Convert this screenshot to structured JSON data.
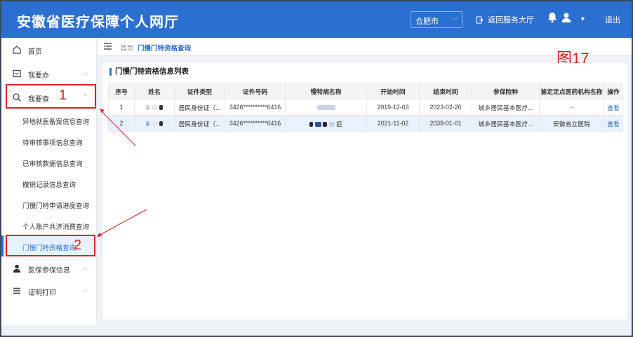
{
  "header": {
    "title": "安徽省医疗保障个人网厅",
    "city": "合肥市",
    "return_hall": "返回服务大厅",
    "logout": "退出"
  },
  "sidebar": {
    "items": [
      {
        "label": "首页"
      },
      {
        "label": "我要办"
      },
      {
        "label": "我要查"
      },
      {
        "label": "医保参保信息"
      },
      {
        "label": "证明打印"
      }
    ],
    "sub_items": [
      {
        "label": "异地就医备案信息查询"
      },
      {
        "label": "待审核事项信息查询"
      },
      {
        "label": "已审核数据信息查询"
      },
      {
        "label": "撤销记录信息查询"
      },
      {
        "label": "门慢门特申请进度查询"
      },
      {
        "label": "个人账户共济消费查询"
      },
      {
        "label": "门慢门特资格查询"
      }
    ]
  },
  "tabs": {
    "home": "首页",
    "active": "门慢门特资格查询",
    "close": "×"
  },
  "annotations": {
    "figure": "图17",
    "marker_1": "1",
    "marker_2": "2"
  },
  "panel": {
    "title": "门慢门特资格信息列表"
  },
  "table": {
    "headers": [
      "序号",
      "姓名",
      "证件类型",
      "证件号码",
      "慢特病名称",
      "开始时间",
      "结束时间",
      "参保险种",
      "鉴定定点医药机构名称",
      "操作"
    ],
    "rows": [
      {
        "seq": "1",
        "id_type": "居民身份证（...",
        "id_no": "3426**********6416",
        "disease": "",
        "start": "2019-12-03",
        "end": "2023-02-20",
        "insurance": "城乡居民基本医疗...",
        "institution": "-",
        "action": "查看"
      },
      {
        "seq": "2",
        "id_type": "居民身份证（...",
        "id_no": "3426**********6416",
        "disease": "症",
        "start": "2021-11-02",
        "end": "2038-01-01",
        "insurance": "城乡居民基本医疗...",
        "institution": "安徽省立医院",
        "action": "查看"
      }
    ]
  },
  "colors": {
    "primary": "#2b6fd1",
    "annotation_red": "#e02020"
  }
}
